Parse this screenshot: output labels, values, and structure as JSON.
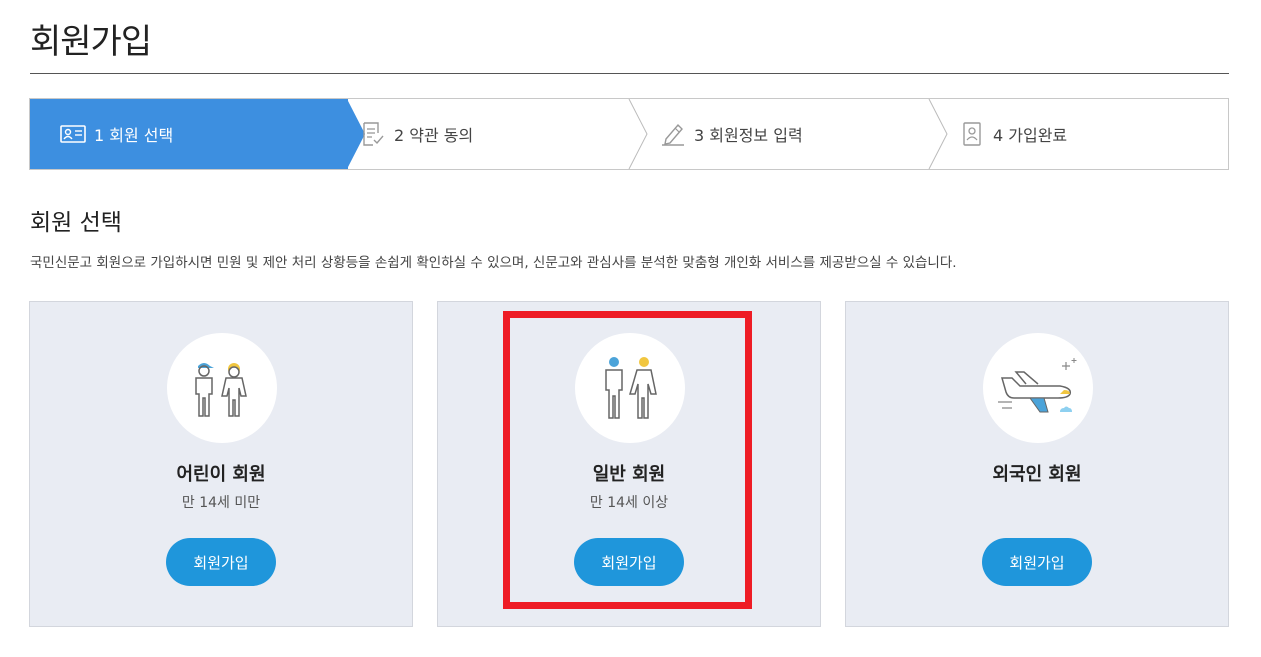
{
  "page": {
    "title": "회원가입"
  },
  "steps": [
    {
      "label": "1 회원 선택",
      "icon": "member-card-icon",
      "active": true
    },
    {
      "label": "2 약관 동의",
      "icon": "document-check-icon",
      "active": false
    },
    {
      "label": "3 회원정보 입력",
      "icon": "pencil-write-icon",
      "active": false
    },
    {
      "label": "4 가입완료",
      "icon": "id-badge-icon",
      "active": false
    }
  ],
  "section": {
    "title": "회원 선택",
    "description": "국민신문고 회원으로 가입하시면 민원 및 제안 처리 상황등을 손쉽게 확인하실 수 있으며, 신문고와 관심사를 분석한 맞춤형 개인화 서비스를 제공받으실 수 있습니다."
  },
  "cards": [
    {
      "name": "어린이 회원",
      "sub": "만 14세 미만",
      "button": "회원가입",
      "icon": "children-icon"
    },
    {
      "name": "일반 회원",
      "sub": "만 14세 이상",
      "button": "회원가입",
      "icon": "adults-icon"
    },
    {
      "name": "외국인 회원",
      "sub": "",
      "button": "회원가입",
      "icon": "airplane-icon"
    }
  ],
  "colors": {
    "accent": "#3d8fe0",
    "button": "#1f96db",
    "card_bg": "#e9ecf3",
    "highlight": "#ee1c25"
  }
}
